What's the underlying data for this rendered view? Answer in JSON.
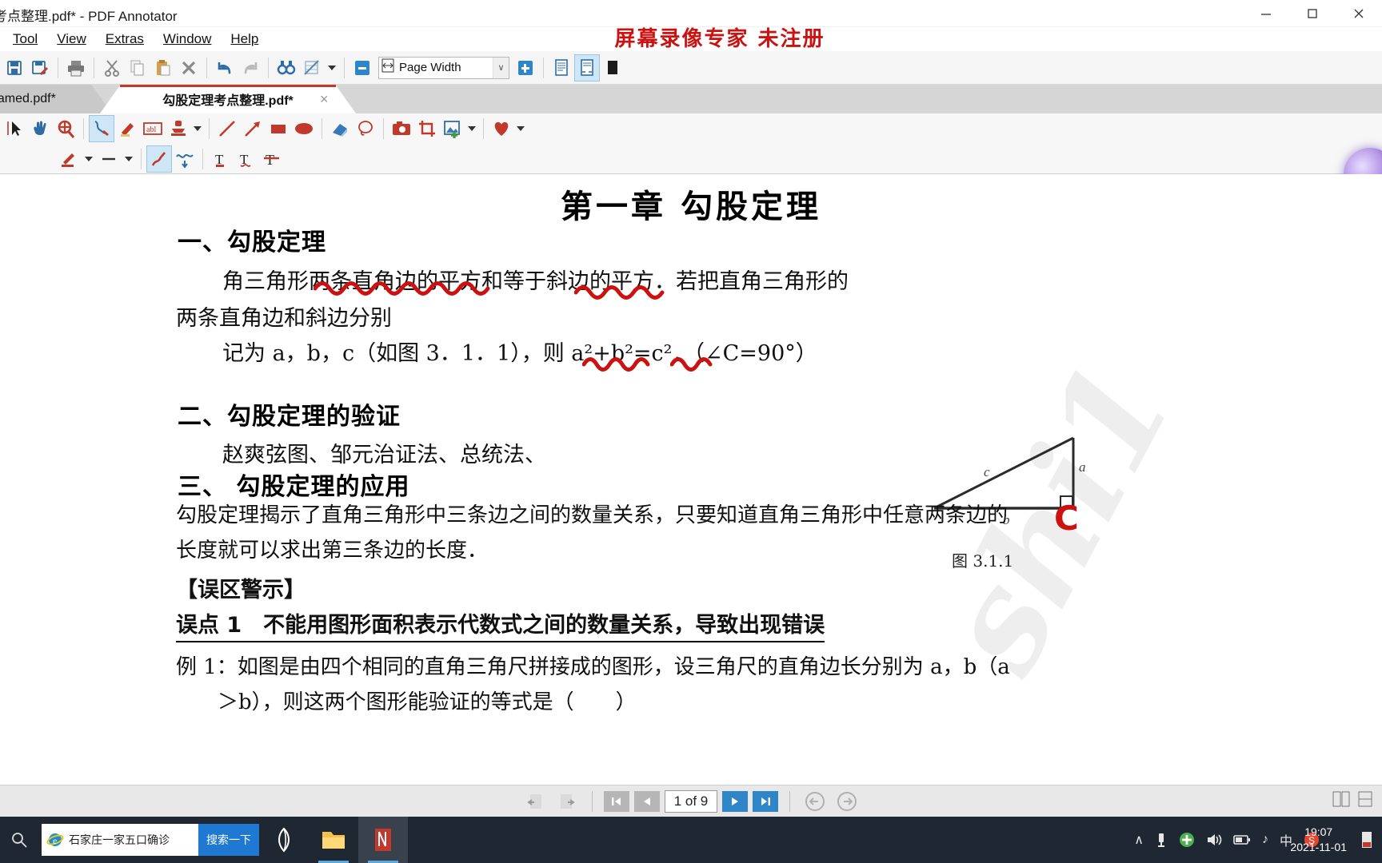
{
  "window": {
    "title": "考点整理.pdf* - PDF Annotator",
    "minimize_label": "−",
    "maximize_label": "□",
    "close_label": "×"
  },
  "menubar": {
    "items": [
      {
        "label": "Tool",
        "accel": "T"
      },
      {
        "label": "View",
        "accel": "V"
      },
      {
        "label": "Extras",
        "accel": "x"
      },
      {
        "label": "Window",
        "accel": "W"
      },
      {
        "label": "Help",
        "accel": "H"
      }
    ]
  },
  "recorder_banner": "屏幕录像专家  未注册",
  "toolbar_main": {
    "buttons": [
      {
        "name": "save-icon",
        "title": "Save"
      },
      {
        "name": "save-as-icon",
        "title": "Save As"
      },
      {
        "name": "print-icon",
        "title": "Print"
      },
      {
        "name": "cut-icon",
        "title": "Cut"
      },
      {
        "name": "copy-icon",
        "title": "Copy"
      },
      {
        "name": "paste-icon",
        "title": "Paste"
      },
      {
        "name": "delete-icon",
        "title": "Delete"
      },
      {
        "name": "undo-icon",
        "title": "Undo"
      },
      {
        "name": "redo-icon",
        "title": "Redo"
      },
      {
        "name": "find-icon",
        "title": "Find"
      },
      {
        "name": "erase-page-icon",
        "title": "Clear"
      },
      {
        "name": "dropdown-caret-icon",
        "title": "More"
      }
    ],
    "zoom_out_label": "−",
    "zoom_value": "Page Width",
    "zoom_caret": "∨",
    "zoom_in_label": "+",
    "view_single_page": "Single Page",
    "view_fit_page": "Fit Page",
    "view_full_screen": "Full Screen"
  },
  "tabs": [
    {
      "label": "named.pdf*",
      "active": false
    },
    {
      "label": "勾股定理考点整理.pdf*",
      "active": true,
      "close": "×"
    }
  ],
  "toolbar_annotate": {
    "buttons": [
      {
        "name": "select-cursor-icon"
      },
      {
        "name": "pan-hand-icon"
      },
      {
        "name": "zoom-magnifier-icon"
      },
      {
        "name": "pen-tool-icon",
        "selected": true
      },
      {
        "name": "highlighter-icon"
      },
      {
        "name": "text-box-icon"
      },
      {
        "name": "stamp-icon"
      },
      {
        "name": "stamp-caret-icon"
      },
      {
        "name": "line-icon"
      },
      {
        "name": "arrow-icon"
      },
      {
        "name": "rectangle-icon"
      },
      {
        "name": "ellipse-icon"
      },
      {
        "name": "eraser-icon"
      },
      {
        "name": "lasso-icon"
      },
      {
        "name": "snapshot-camera-icon"
      },
      {
        "name": "crop-icon"
      },
      {
        "name": "insert-image-icon"
      },
      {
        "name": "insert-image-caret-icon"
      },
      {
        "name": "favorite-heart-icon"
      },
      {
        "name": "favorite-caret-icon"
      }
    ]
  },
  "toolbar_pen": {
    "buttons": [
      {
        "name": "pen-color-icon"
      },
      {
        "name": "pen-color-caret-icon"
      },
      {
        "name": "pen-width-icon"
      },
      {
        "name": "pen-width-caret-icon"
      },
      {
        "name": "freehand-smooth-icon",
        "selected": true
      },
      {
        "name": "squiggle-icon"
      },
      {
        "name": "text-style-icon"
      },
      {
        "name": "text-subscript-icon"
      },
      {
        "name": "text-strikethrough-icon"
      }
    ]
  },
  "document": {
    "title": "第一章  勾股定理",
    "sections": [
      {
        "heading": "一、勾股定理",
        "lines": [
          "角三角形两条直角边的平方和等于斜边的平方．若把直角三角形的",
          "两条直角边和斜边分别",
          "记为 a，b，c（如图 3．1．1），则 a²+b²=c²．（∠C=90°）"
        ]
      },
      {
        "heading": "二、勾股定理的验证",
        "lines": [
          "赵爽弦图、邹元治证法、总统法、"
        ]
      },
      {
        "heading": "三、 勾股定理的应用",
        "lines": [
          "勾股定理揭示了直角三角形中三条边之间的数量关系，只要知道直角三角形中任意两条边的",
          "长度就可以求出第三条边的长度．"
        ]
      }
    ],
    "warning_heading": "【误区警示】",
    "mistake_point": "误点 1　不能用图形面积表示代数式之间的数量关系，导致出现错误",
    "example_lines": [
      "例 1：如图是由四个相同的直角三角尺拼接成的图形，设三角尺的直角边长分别为 a，b（a",
      "＞b），则这两个图形能验证的等式是（　　）"
    ],
    "figure": {
      "label_a": "a",
      "label_b": "b",
      "label_c": "c",
      "caption": "图 3.1.1",
      "annotation_C": "C"
    },
    "watermark": "shi1"
  },
  "navbar": {
    "prev_view_label": "◀",
    "next_view_label": "▶",
    "first_page_label": "|◀",
    "prev_page_label": "◀",
    "page_indicator": "1 of 9",
    "next_page_label": "▶",
    "last_page_label": "▶|",
    "back_label": "←",
    "forward_label": "→"
  },
  "taskbar": {
    "search_placeholder": "石家庄一家五口确诊",
    "search_button": "搜索一下",
    "apps": [
      {
        "name": "task-browser-icon"
      },
      {
        "name": "task-explorer-icon"
      },
      {
        "name": "task-pdf-annotator-icon",
        "active": true
      }
    ],
    "tray": [
      {
        "name": "tray-chevron-up-icon",
        "glyph": "∧"
      },
      {
        "name": "tray-usb-icon",
        "glyph": "🖴"
      },
      {
        "name": "tray-shield-icon",
        "glyph": "✚"
      },
      {
        "name": "tray-volume-icon",
        "glyph": "🔊"
      },
      {
        "name": "tray-battery-icon",
        "glyph": "▭"
      },
      {
        "name": "tray-music-icon",
        "glyph": "♪"
      },
      {
        "name": "tray-ime-icon",
        "glyph": "中"
      },
      {
        "name": "tray-sogou-icon",
        "glyph": "S"
      }
    ],
    "time": "19:07",
    "date": "2021-11-01"
  },
  "colors": {
    "accent_red": "#cc1111",
    "accent_blue": "#2e86c8",
    "taskbar_bg": "#1f2733",
    "toolbar_bg": "#f5f5f5"
  }
}
